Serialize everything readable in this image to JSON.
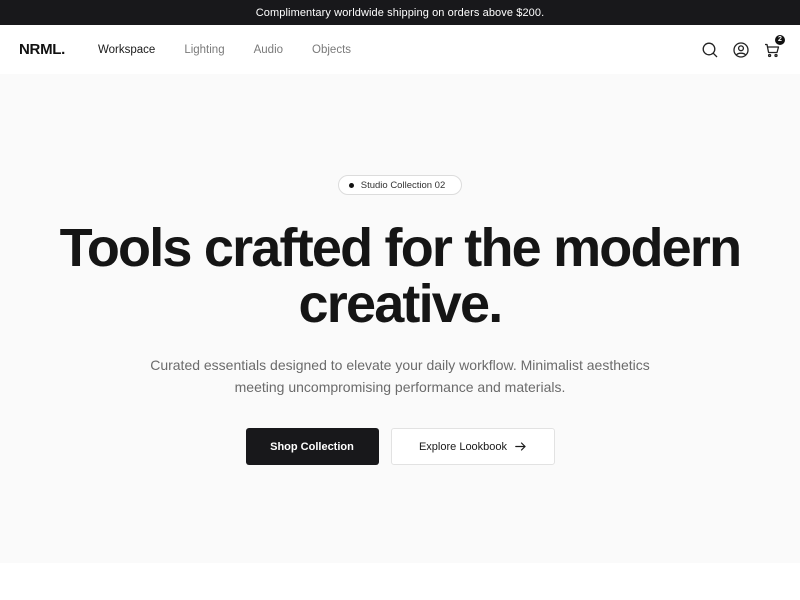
{
  "announcement": {
    "text": "Complimentary worldwide shipping on orders above $200."
  },
  "header": {
    "logo": "NRML.",
    "nav": [
      {
        "label": "Workspace",
        "active": true
      },
      {
        "label": "Lighting",
        "active": false
      },
      {
        "label": "Audio",
        "active": false
      },
      {
        "label": "Objects",
        "active": false
      }
    ],
    "icons": [
      "search-icon",
      "account-icon",
      "cart-icon"
    ],
    "cart_count": "2"
  },
  "hero": {
    "badge": "Studio Collection 02",
    "headline_line1": "Tools crafted for the modern",
    "headline_line2": "creative.",
    "subtext_line1": "Curated essentials designed to elevate your daily workflow. Minimalist aesthetics",
    "subtext_line2": "meeting uncompromising performance and materials.",
    "primary_cta": "Shop Collection",
    "secondary_cta": "Explore Lookbook"
  },
  "colors": {
    "dark": "#18181b",
    "hero_bg": "#fafafa",
    "muted_text": "#6b6b6b"
  }
}
